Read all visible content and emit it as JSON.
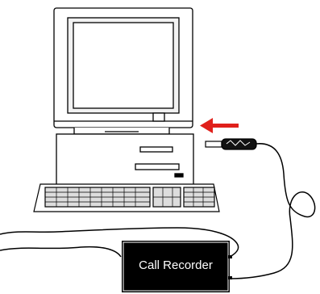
{
  "recorder": {
    "label": "Call Recorder"
  },
  "colors": {
    "outline": "#000000",
    "arrow": "#e0201b",
    "box": "#000000",
    "background": "#ffffff",
    "screen": "#f2f2f2"
  },
  "icons": [
    "computer-monitor-icon",
    "computer-tower-icon",
    "keyboard-icon",
    "usb-plug-icon",
    "left-arrow-icon"
  ]
}
